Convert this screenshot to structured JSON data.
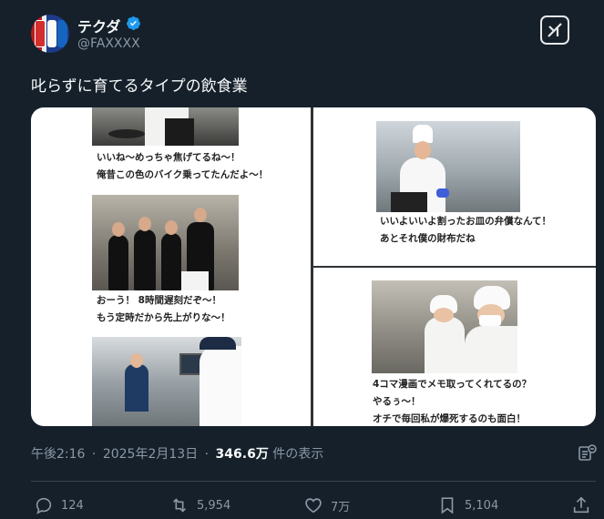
{
  "author": {
    "display_name": "テクダ",
    "handle": "@FAXXXX",
    "verified": true,
    "avatar_icon": "cola-cans-avatar"
  },
  "header": {
    "grok_icon": "grok-icon"
  },
  "tweet": {
    "text": "叱らずに育てるタイプの飲食業"
  },
  "media": {
    "panels": [
      {
        "captions": [
          "いいね〜めっちゃ焦げてるね〜！",
          "俺昔この色のバイク乗ってたんだよ〜！"
        ]
      },
      {
        "captions": [
          "おーう！ 8時間遅刻だぞ〜！",
          "もう定時だから先上がりな〜！"
        ]
      },
      {
        "captions": [
          "いいよいいよ割ったお皿の弁償なんて！",
          "あとそれ僕の財布だね"
        ]
      },
      {
        "captions": [
          "4コマ漫画でメモ取ってくれてるの？",
          "やるぅ〜！",
          "オチで毎回私が爆死するのも面白！"
        ]
      }
    ]
  },
  "meta": {
    "time": "午後2:16",
    "separator": "·",
    "date": "2025年2月13日",
    "views": "346.6万",
    "views_label": "件の表示"
  },
  "actions": {
    "reply_count": "124",
    "retweet_count": "5,954",
    "like_count": "7万",
    "bookmark_count": "5,104"
  },
  "colors": {
    "background": "#15202b",
    "verified": "#1d9bf0",
    "muted": "#8b98a5"
  }
}
